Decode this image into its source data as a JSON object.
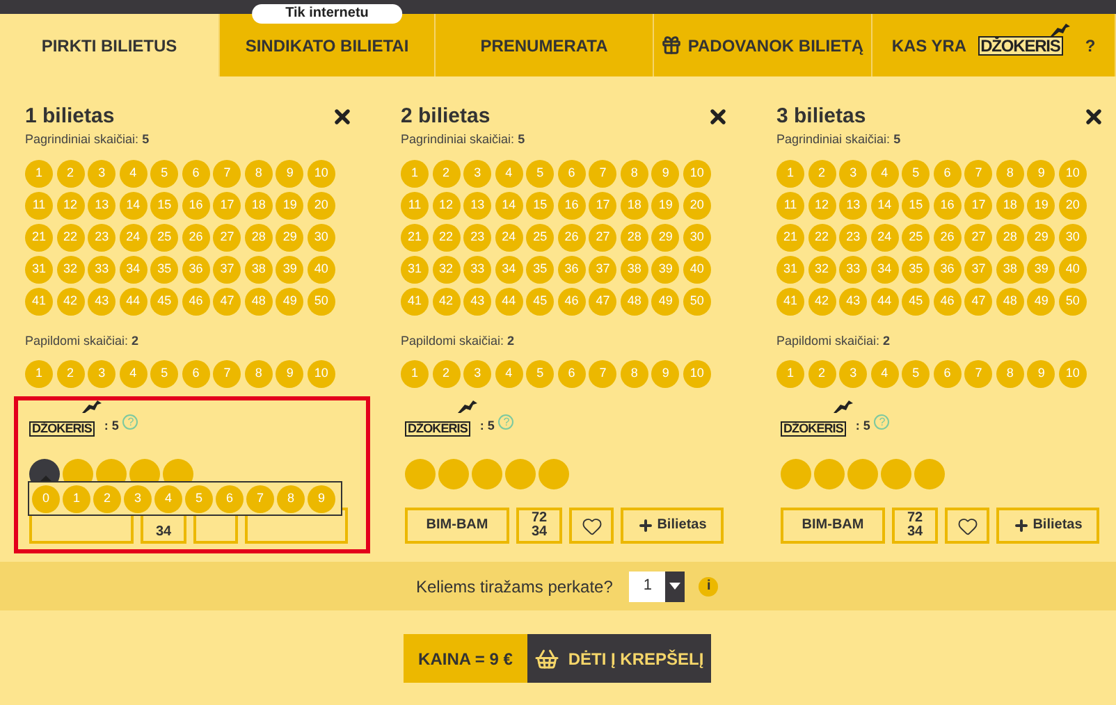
{
  "tabs": [
    {
      "label": "PIRKTI BILIETUS",
      "selected": true
    },
    {
      "label": "SINDIKATO BILIETAI",
      "selected": false,
      "badge": "Tik internetu"
    },
    {
      "label": "PRENUMERATA",
      "selected": false
    },
    {
      "label": "PADOVANOK BILIETĄ",
      "selected": false,
      "kind": "gift"
    },
    {
      "label": "KAS YRA",
      "selected": false,
      "kind": "logo",
      "logo_text": "DŽOKERIS",
      "suffix": "?"
    }
  ],
  "tickets": [
    {
      "title": "1 bilietas",
      "main_label": "Pagrindiniai skaičiai:",
      "main_count": "5",
      "main_numbers": [
        "1",
        "2",
        "3",
        "4",
        "5",
        "6",
        "7",
        "8",
        "9",
        "10",
        "11",
        "12",
        "13",
        "14",
        "15",
        "16",
        "17",
        "18",
        "19",
        "20",
        "21",
        "22",
        "23",
        "24",
        "25",
        "26",
        "27",
        "28",
        "29",
        "30",
        "31",
        "32",
        "33",
        "34",
        "35",
        "36",
        "37",
        "38",
        "39",
        "40",
        "41",
        "42",
        "43",
        "44",
        "45",
        "46",
        "47",
        "48",
        "49",
        "50"
      ],
      "extra_label": "Papildomi skaičiai:",
      "extra_count": "2",
      "extra_numbers": [
        "1",
        "2",
        "3",
        "4",
        "5",
        "6",
        "7",
        "8",
        "9",
        "10"
      ],
      "joker_logo": "DŽOKERIS",
      "joker_count": ": 5",
      "joker_help": "?",
      "joker": [
        {
          "selected": true
        },
        {
          "selected": false
        },
        {
          "selected": false
        },
        {
          "selected": false
        },
        {
          "selected": false
        }
      ],
      "highlighted": true,
      "picker": [
        "0",
        "1",
        "2",
        "3",
        "4",
        "5",
        "6",
        "7",
        "8",
        "9"
      ],
      "buttons": [
        {
          "kind": "text"
        },
        {
          "kind": "numbers",
          "lines": [
            "34"
          ]
        },
        {
          "kind": "heart"
        },
        {
          "kind": "add"
        }
      ]
    },
    {
      "title": "2 bilietas",
      "main_label": "Pagrindiniai skaičiai:",
      "main_count": "5",
      "main_numbers": [
        "1",
        "2",
        "3",
        "4",
        "5",
        "6",
        "7",
        "8",
        "9",
        "10",
        "11",
        "12",
        "13",
        "14",
        "15",
        "16",
        "17",
        "18",
        "19",
        "20",
        "21",
        "22",
        "23",
        "24",
        "25",
        "26",
        "27",
        "28",
        "29",
        "30",
        "31",
        "32",
        "33",
        "34",
        "35",
        "36",
        "37",
        "38",
        "39",
        "40",
        "41",
        "42",
        "43",
        "44",
        "45",
        "46",
        "47",
        "48",
        "49",
        "50"
      ],
      "extra_label": "Papildomi skaičiai:",
      "extra_count": "2",
      "extra_numbers": [
        "1",
        "2",
        "3",
        "4",
        "5",
        "6",
        "7",
        "8",
        "9",
        "10"
      ],
      "joker_logo": "DŽOKERIS",
      "joker_count": ": 5",
      "joker_help": "?",
      "joker": [
        {
          "selected": false
        },
        {
          "selected": false
        },
        {
          "selected": false
        },
        {
          "selected": false
        },
        {
          "selected": false
        }
      ],
      "highlighted": false,
      "buttons": [
        {
          "kind": "text",
          "label": "BIM-BAM"
        },
        {
          "kind": "numbers",
          "lines": [
            "72",
            "34"
          ]
        },
        {
          "kind": "heart"
        },
        {
          "kind": "add",
          "label": "Bilietas"
        }
      ]
    },
    {
      "title": "3 bilietas",
      "main_label": "Pagrindiniai skaičiai:",
      "main_count": "5",
      "main_numbers": [
        "1",
        "2",
        "3",
        "4",
        "5",
        "6",
        "7",
        "8",
        "9",
        "10",
        "11",
        "12",
        "13",
        "14",
        "15",
        "16",
        "17",
        "18",
        "19",
        "20",
        "21",
        "22",
        "23",
        "24",
        "25",
        "26",
        "27",
        "28",
        "29",
        "30",
        "31",
        "32",
        "33",
        "34",
        "35",
        "36",
        "37",
        "38",
        "39",
        "40",
        "41",
        "42",
        "43",
        "44",
        "45",
        "46",
        "47",
        "48",
        "49",
        "50"
      ],
      "extra_label": "Papildomi skaičiai:",
      "extra_count": "2",
      "extra_numbers": [
        "1",
        "2",
        "3",
        "4",
        "5",
        "6",
        "7",
        "8",
        "9",
        "10"
      ],
      "joker_logo": "DŽOKERIS",
      "joker_count": ": 5",
      "joker_help": "?",
      "joker": [
        {
          "selected": false
        },
        {
          "selected": false
        },
        {
          "selected": false
        },
        {
          "selected": false
        },
        {
          "selected": false
        }
      ],
      "highlighted": false,
      "buttons": [
        {
          "kind": "text",
          "label": "BIM-BAM"
        },
        {
          "kind": "numbers",
          "lines": [
            "72",
            "34"
          ]
        },
        {
          "kind": "heart"
        },
        {
          "kind": "add",
          "label": "Bilietas"
        }
      ]
    }
  ],
  "draws": {
    "label": "Keliems tiražams perkate?",
    "value": "1",
    "info": "i"
  },
  "price": "KAINA = 9 €",
  "cart_button": "DĖTI Į KREPŠELĮ"
}
